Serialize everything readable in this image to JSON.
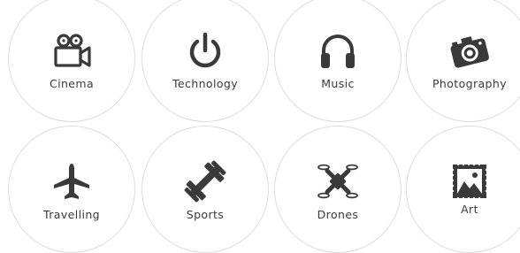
{
  "categories": [
    {
      "id": "cinema",
      "label": "Cinema",
      "icon": "film-camera-icon"
    },
    {
      "id": "technology",
      "label": "Technology",
      "icon": "power-icon"
    },
    {
      "id": "music",
      "label": "Music",
      "icon": "headphones-icon"
    },
    {
      "id": "photography",
      "label": "Photography",
      "icon": "photo-camera-icon"
    },
    {
      "id": "travelling",
      "label": "Travelling",
      "icon": "airplane-icon"
    },
    {
      "id": "sports",
      "label": "Sports",
      "icon": "dumbbell-icon"
    },
    {
      "id": "drones",
      "label": "Drones",
      "icon": "drone-icon"
    },
    {
      "id": "art",
      "label": "Art",
      "icon": "framed-picture-icon"
    }
  ],
  "colors": {
    "icon": "#3a3a3a",
    "border": "#dcdcdc",
    "text": "#3a3a3a",
    "background": "#ffffff"
  }
}
